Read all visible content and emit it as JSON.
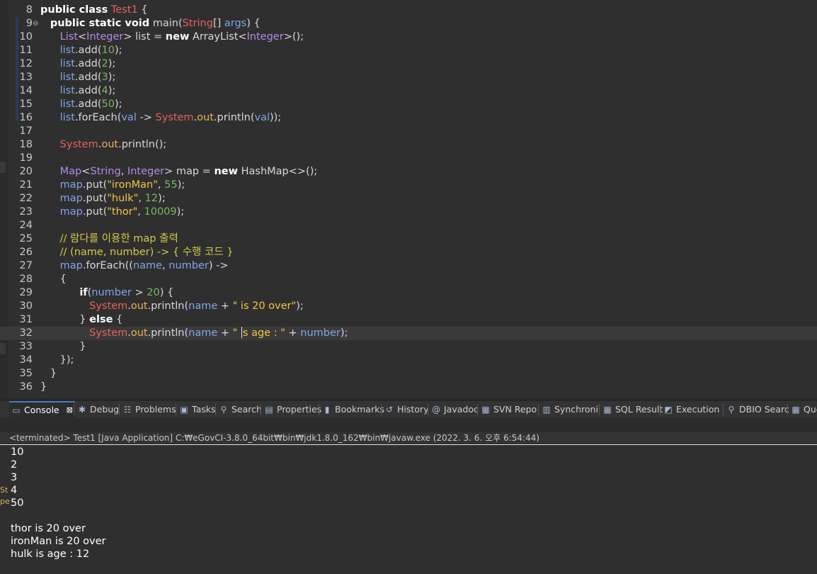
{
  "editor": {
    "lines": [
      {
        "n": "8",
        "html": "<span class='kw'>public class</span> <span class='cls'>Test1</span> {"
      },
      {
        "n": "9",
        "fold": "⊖",
        "html": "   <span class='kw'>public static void</span> main(<span class='cls'>String</span>[] <span class='var'>args</span>) {"
      },
      {
        "n": "10",
        "html": "      <span class='iface'>List</span>&lt;<span class='iface'>Integer</span>&gt; list = <span class='kw'>new</span> ArrayList&lt;<span class='iface'>Integer</span>&gt;();"
      },
      {
        "n": "11",
        "html": "      <span class='var'>list</span>.add(<span class='num'>10</span>);"
      },
      {
        "n": "12",
        "html": "      <span class='var'>list</span>.add(<span class='num'>2</span>);"
      },
      {
        "n": "13",
        "html": "      <span class='var'>list</span>.add(<span class='num'>3</span>);"
      },
      {
        "n": "14",
        "html": "      <span class='var'>list</span>.add(<span class='num'>4</span>);"
      },
      {
        "n": "15",
        "html": "      <span class='var'>list</span>.add(<span class='num'>50</span>);"
      },
      {
        "n": "16",
        "html": "      <span class='var'>list</span>.forEach(<span class='par'>val</span> -&gt; <span class='cls'>System</span>.<span class='fld'>out</span>.println(<span class='par'>val</span>));"
      },
      {
        "n": "17",
        "html": ""
      },
      {
        "n": "18",
        "html": "      <span class='cls'>System</span>.<span class='fld'>out</span>.println();"
      },
      {
        "n": "19",
        "html": ""
      },
      {
        "n": "20",
        "html": "      <span class='iface'>Map</span>&lt;<span class='iface'>String</span>, <span class='iface'>Integer</span>&gt; map = <span class='kw'>new</span> HashMap&lt;&gt;();"
      },
      {
        "n": "21",
        "html": "      <span class='var'>map</span>.put(<span class='str'>\"ironMan\"</span>, <span class='num'>55</span>);"
      },
      {
        "n": "22",
        "html": "      <span class='var'>map</span>.put(<span class='str'>\"hulk\"</span>, <span class='num'>12</span>);"
      },
      {
        "n": "23",
        "html": "      <span class='var'>map</span>.put(<span class='str'>\"thor\"</span>, <span class='num'>10009</span>);"
      },
      {
        "n": "24",
        "html": ""
      },
      {
        "n": "25",
        "html": "      <span class='cmt'>// 람다를 이용한 map 출력</span>"
      },
      {
        "n": "26",
        "html": "      <span class='cmt'>// (name, number) -&gt; { 수행 코드 }</span>"
      },
      {
        "n": "27",
        "html": "      <span class='var'>map</span>.forEach((<span class='par'>name</span>, <span class='par'>number</span>) -&gt;"
      },
      {
        "n": "28",
        "html": "      {"
      },
      {
        "n": "29",
        "html": "            <span class='kw'>if</span>(<span class='par'>number</span> &gt; <span class='num'>20</span>) {"
      },
      {
        "n": "30",
        "html": "               <span class='cls'>System</span>.<span class='fld'>out</span>.println(<span class='par'>name</span> + <span class='str'>\" is 20 over\"</span>);"
      },
      {
        "n": "31",
        "html": "            } <span class='kw'>else</span> {"
      },
      {
        "n": "32",
        "current": true,
        "html": "               <span class='cls'>System</span>.<span class='fld'>out</span>.println(<span class='par'>name</span> + <span class='str'>\" <span class='caret'></span>s age : \"</span> + <span class='par'>number</span>);"
      },
      {
        "n": "33",
        "html": "            }"
      },
      {
        "n": "34",
        "html": "      });"
      },
      {
        "n": "35",
        "html": "   }"
      },
      {
        "n": "36",
        "html": "}"
      }
    ]
  },
  "tabs": [
    {
      "label": "Console",
      "icon": "▭",
      "icon_name": "console-icon",
      "active": true,
      "close": "⊠"
    },
    {
      "label": "Debug",
      "icon": "✱",
      "icon_name": "debug-icon"
    },
    {
      "label": "Problems",
      "icon": "☷",
      "icon_name": "problems-icon"
    },
    {
      "label": "Tasks",
      "icon": "▣",
      "icon_name": "tasks-icon"
    },
    {
      "label": "Search",
      "icon": "⚲",
      "icon_name": "search-icon"
    },
    {
      "label": "Properties",
      "icon": "▤",
      "icon_name": "properties-icon"
    },
    {
      "label": "Bookmarks",
      "icon": "▮",
      "icon_name": "bookmark-icon"
    },
    {
      "label": "History",
      "icon": "↺",
      "icon_name": "history-icon"
    },
    {
      "label": "Javadoc",
      "icon": "@",
      "icon_name": "javadoc-icon"
    },
    {
      "label": "SVN Repo",
      "icon": "▦",
      "icon_name": "svn-repo-icon"
    },
    {
      "label": "Synchroni",
      "icon": "▥",
      "icon_name": "synchronize-icon"
    },
    {
      "label": "SQL Result",
      "icon": "▦",
      "icon_name": "sql-result-icon"
    },
    {
      "label": "Execution",
      "icon": "◩",
      "icon_name": "execution-icon"
    },
    {
      "label": "DBIO Searc",
      "icon": "⚲",
      "icon_name": "dbio-search-icon"
    },
    {
      "label": "Que",
      "icon": "▦",
      "icon_name": "query-icon"
    }
  ],
  "console": {
    "status": "<terminated> Test1 [Java Application] C:₩eGovCI-3.8.0_64bit₩bin₩jdk1.8.0_162₩bin₩javaw.exe  (2022. 3. 6. 오후 6:54:44)",
    "output": [
      "10",
      "2",
      "3",
      "4",
      "50",
      "",
      "thor is 20 over",
      "ironMan is 20 over",
      "hulk is age : 12"
    ]
  },
  "side_fragment": [
    "St",
    "pe"
  ]
}
